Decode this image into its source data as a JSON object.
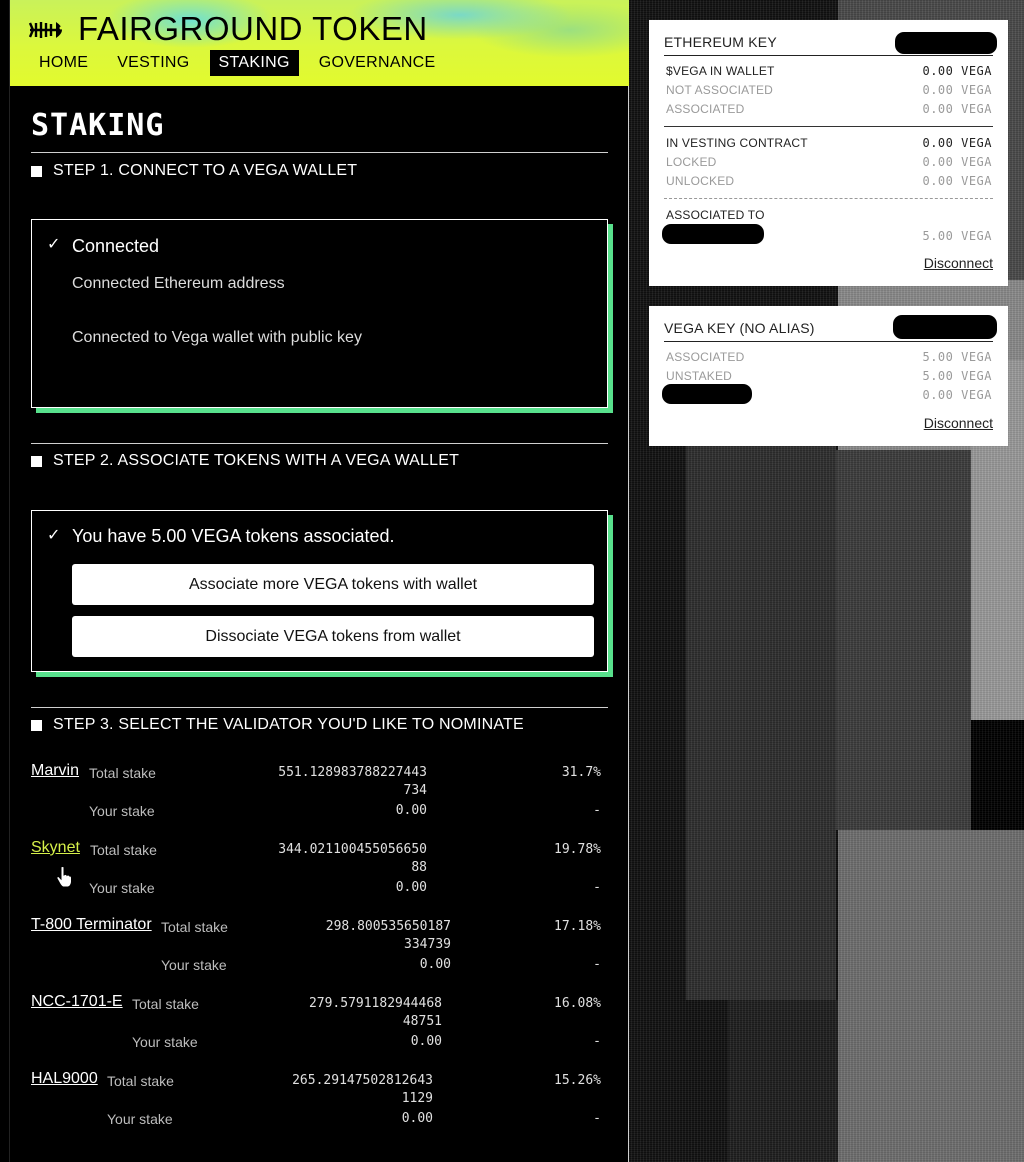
{
  "header": {
    "app_title": "FAIRGROUND TOKEN",
    "logo_icon": "fish-skeleton-icon",
    "nav": [
      {
        "label": "HOME",
        "active": false
      },
      {
        "label": "VESTING",
        "active": false
      },
      {
        "label": "STAKING",
        "active": true
      },
      {
        "label": "GOVERNANCE",
        "active": false
      }
    ]
  },
  "page": {
    "title": "STAKING"
  },
  "step1": {
    "heading": "STEP 1. CONNECT TO A VEGA WALLET",
    "status": "Connected",
    "eth_line": "Connected Ethereum address",
    "vega_line": "Connected to Vega wallet with public key"
  },
  "step2": {
    "heading": "STEP 2. ASSOCIATE TOKENS WITH A VEGA WALLET",
    "status": "You have 5.00 VEGA tokens associated.",
    "associate_button": "Associate more VEGA tokens with wallet",
    "dissociate_button": "Dissociate VEGA tokens from wallet"
  },
  "step3": {
    "heading": "STEP 3. SELECT THE VALIDATOR YOU'D LIKE TO NOMINATE",
    "total_label": "Total stake",
    "your_label": "Your stake",
    "validators": [
      {
        "name": "Marvin",
        "total_l1": "551.128983788227443",
        "total_l2": "734",
        "your": "0.00",
        "pct": "31.7%",
        "your_pct": "-"
      },
      {
        "name": "Skynet",
        "total_l1": "344.021100455056650",
        "total_l2": "88",
        "your": "0.00",
        "pct": "19.78%",
        "your_pct": "-"
      },
      {
        "name": "T-800 Terminator",
        "total_l1": "298.800535650187",
        "total_l2": "334739",
        "your": "0.00",
        "pct": "17.18%",
        "your_pct": "-"
      },
      {
        "name": "NCC-1701-E",
        "total_l1": "279.5791182944468",
        "total_l2": "48751",
        "your": "0.00",
        "pct": "16.08%",
        "your_pct": "-"
      },
      {
        "name": "HAL9000",
        "total_l1": "265.29147502812643",
        "total_l2": "1129",
        "your": "0.00",
        "pct": "15.26%",
        "your_pct": "-"
      }
    ]
  },
  "eth_panel": {
    "title": "ETHEREUM KEY",
    "rows": [
      {
        "label": "$VEGA IN WALLET",
        "amount": "0.00 VEGA"
      },
      {
        "label": "NOT ASSOCIATED",
        "amount": "0.00 VEGA"
      },
      {
        "label": "ASSOCIATED",
        "amount": "0.00 VEGA"
      },
      {
        "label": "IN VESTING CONTRACT",
        "amount": "0.00 VEGA"
      },
      {
        "label": "LOCKED",
        "amount": "0.00 VEGA"
      },
      {
        "label": "UNLOCKED",
        "amount": "0.00 VEGA"
      },
      {
        "label": "ASSOCIATED TO",
        "amount": ""
      },
      {
        "label": "",
        "amount": "5.00 VEGA"
      }
    ],
    "disconnect": "Disconnect"
  },
  "vega_panel": {
    "title": "VEGA KEY (NO ALIAS)",
    "rows": [
      {
        "label": "ASSOCIATED",
        "amount": "5.00 VEGA"
      },
      {
        "label": "UNSTAKED",
        "amount": "5.00 VEGA"
      },
      {
        "label": "",
        "amount": "0.00 VEGA"
      }
    ],
    "disconnect": "Disconnect"
  },
  "colors": {
    "accent_green": "#58e08c",
    "header_yellow": "#dcf83c",
    "link_hover": "#d6f04a"
  }
}
